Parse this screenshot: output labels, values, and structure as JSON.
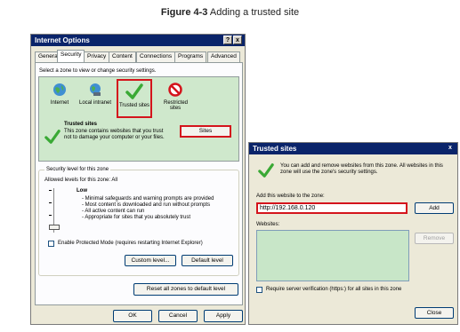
{
  "figure": {
    "title_bold": "Figure 4-3",
    "title_rest": " Adding a trusted site"
  },
  "internet_options": {
    "title": "Internet Options",
    "title_buttons": [
      "?",
      "x"
    ],
    "tabs": [
      "General",
      "Security",
      "Privacy",
      "Content",
      "Connections",
      "Programs",
      "Advanced"
    ],
    "zone_prompt": "Select a zone to view or change security settings.",
    "zones": [
      "Internet",
      "Local intranet",
      "Trusted sites",
      "Restricted sites"
    ],
    "selected_zone_title": "Trusted sites",
    "selected_zone_desc": "This zone contains websites that you trust not to damage your computer or your files.",
    "sites_button": "Sites",
    "security_group_title": "Security level for this zone",
    "allowed_levels": "Allowed levels for this zone: All",
    "level_name": "Low",
    "level_bullets": [
      "- Minimal safeguards and warning prompts are provided",
      "- Most content is downloaded and run without prompts",
      "- All active content can run",
      "- Appropriate for sites that you absolutely trust"
    ],
    "protected_mode_label": "Enable Protected Mode (requires restarting Internet Explorer)",
    "custom_level_button": "Custom level...",
    "default_level_button": "Default level",
    "reset_all_button": "Reset all zones to default level",
    "ok_button": "OK",
    "cancel_button": "Cancel",
    "apply_button": "Apply"
  },
  "trusted_sites": {
    "title": "Trusted sites",
    "close_glyph": "x",
    "info_text": "You can add and remove websites from this zone. All websites in this zone will use the zone's security settings.",
    "add_label": "Add this website to the zone:",
    "add_value": "http://192.168.0.120",
    "add_button": "Add",
    "websites_label": "Websites:",
    "remove_button": "Remove",
    "verify_label": "Require server verification (https:) for all sites in this zone",
    "close_button": "Close"
  },
  "colors": {
    "highlight_red": "#d4141c",
    "titlebar": "#0a246a",
    "list_green": "#c8e6c8",
    "zone_bar_green": "#cfe8cc"
  }
}
